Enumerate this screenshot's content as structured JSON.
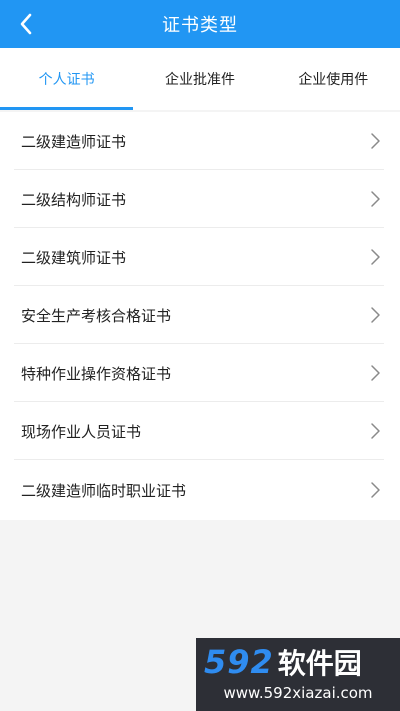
{
  "header": {
    "title": "证书类型",
    "back_icon": "chevron-left-icon"
  },
  "tabs": [
    {
      "label": "个人证书",
      "active": true
    },
    {
      "label": "企业批准件",
      "active": false
    },
    {
      "label": "企业使用件",
      "active": false
    }
  ],
  "list": {
    "items": [
      {
        "label": "二级建造师证书"
      },
      {
        "label": "二级结构师证书"
      },
      {
        "label": "二级建筑师证书"
      },
      {
        "label": "安全生产考核合格证书"
      },
      {
        "label": "特种作业操作资格证书"
      },
      {
        "label": "现场作业人员证书"
      },
      {
        "label": "二级建造师临时职业证书"
      }
    ],
    "item_icon": "chevron-right-icon"
  },
  "watermark": {
    "brand_number": "592",
    "brand_name": "软件园",
    "url": "www.592xiazai.com"
  },
  "colors": {
    "accent": "#2196f3",
    "background": "#f4f4f4"
  }
}
